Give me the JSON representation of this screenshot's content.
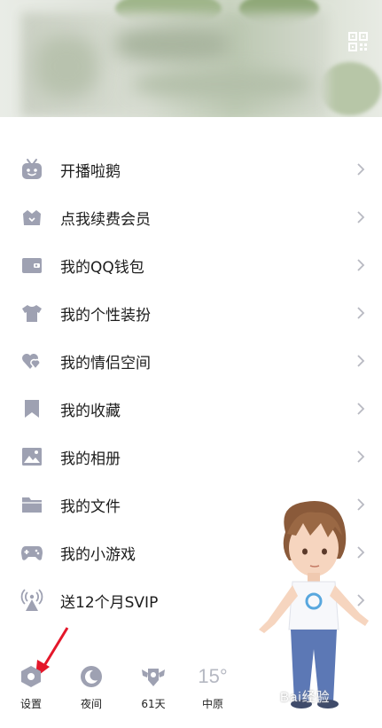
{
  "colors": {
    "icon": "#9ea1b2",
    "chevron": "#b8b9c2",
    "arrow": "#e4172a",
    "text": "#1c1c1c"
  },
  "menu": [
    {
      "label": "开播啦鹅",
      "icon": "tv-icon"
    },
    {
      "label": "点我续费会员",
      "icon": "vip-crown-icon"
    },
    {
      "label": "我的QQ钱包",
      "icon": "wallet-icon"
    },
    {
      "label": "我的个性装扮",
      "icon": "shirt-icon"
    },
    {
      "label": "我的情侣空间",
      "icon": "couple-hearts-icon"
    },
    {
      "label": "我的收藏",
      "icon": "bookmark-icon"
    },
    {
      "label": "我的相册",
      "icon": "photo-icon"
    },
    {
      "label": "我的文件",
      "icon": "folder-icon"
    },
    {
      "label": "我的小游戏",
      "icon": "gamepad-icon"
    },
    {
      "label": "送12个月SVIP",
      "icon": "broadcast-icon"
    }
  ],
  "bottom": {
    "settings": "设置",
    "night": "夜间",
    "days": "61天",
    "temperature": "15°",
    "location": "中原"
  },
  "watermark": "Bai经验"
}
